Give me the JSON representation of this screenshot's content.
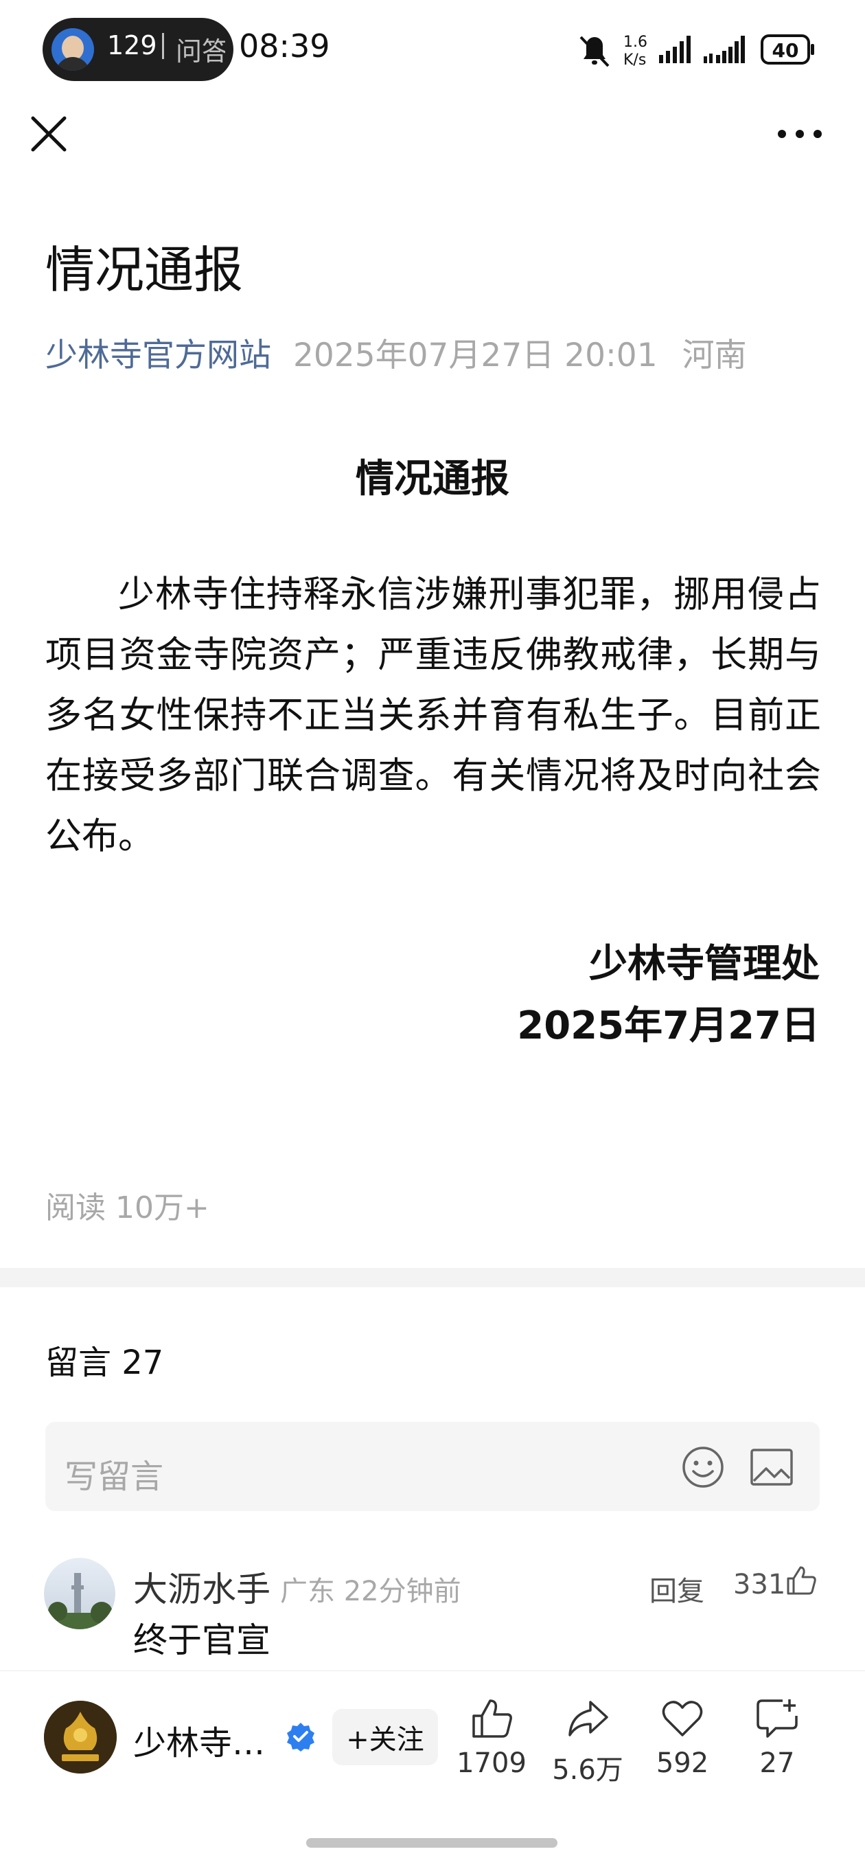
{
  "status_bar": {
    "notification_count": "129",
    "notification_app": "问答",
    "time": "08:39",
    "net_speed_value": "1.6",
    "net_speed_unit": "K/s",
    "battery": "40"
  },
  "article": {
    "title": "情况通报",
    "source": "少林寺官方网站",
    "datetime": "2025年07月27日 20:01",
    "location": "河南",
    "heading": "情况通报",
    "body": "少林寺住持释永信涉嫌刑事犯罪，挪用侵占项目资金寺院资产；严重违反佛教戒律，长期与多名女性保持不正当关系并育有私生子。目前正在接受多部门联合调查。有关情况将及时向社会公布。",
    "signature_org": "少林寺管理处",
    "signature_date": "2025年7月27日",
    "reads": "阅读 10万+"
  },
  "comments": {
    "title": "留言 27",
    "placeholder": "写留言",
    "items": [
      {
        "name": "大沥水手",
        "meta": "广东 22分钟前",
        "reply": "回复",
        "likes": "331",
        "text": "终于官宣"
      }
    ]
  },
  "bottom_bar": {
    "account_name": "少林寺…",
    "follow": "+关注",
    "likes": "1709",
    "shares": "5.6万",
    "favorites": "592",
    "comments": "27"
  }
}
